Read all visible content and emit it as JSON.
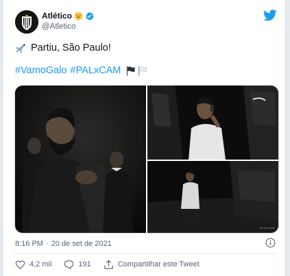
{
  "tweet": {
    "author_name": "Atlético",
    "author_handle": "@Atletico",
    "text_line1": "Partiu, São Paulo!",
    "hashtags": [
      "#VamoGalo",
      "#PALxCAM"
    ],
    "timestamp": "8:16 PM",
    "separator": "·",
    "date": "20 de set de 2021",
    "photo_watermark": "bruno sousa"
  },
  "actions": {
    "likes": "4,2 mil",
    "replies": "191",
    "share_label": "Compartilhar este Tweet"
  },
  "icons": {
    "brand": "twitter-bird-icon",
    "verified": "verified-badge-icon",
    "emoji": "smiling-emoji-icon",
    "plane": "airplane-emoji-icon",
    "flags": [
      "black-flag-icon",
      "white-flag-icon"
    ],
    "info": "info-icon",
    "like": "heart-icon",
    "reply": "reply-icon",
    "share": "share-icon"
  },
  "colors": {
    "link": "#1d9bf0",
    "text": "#0f1419",
    "muted": "#536471",
    "background": "#e6ecf0"
  }
}
